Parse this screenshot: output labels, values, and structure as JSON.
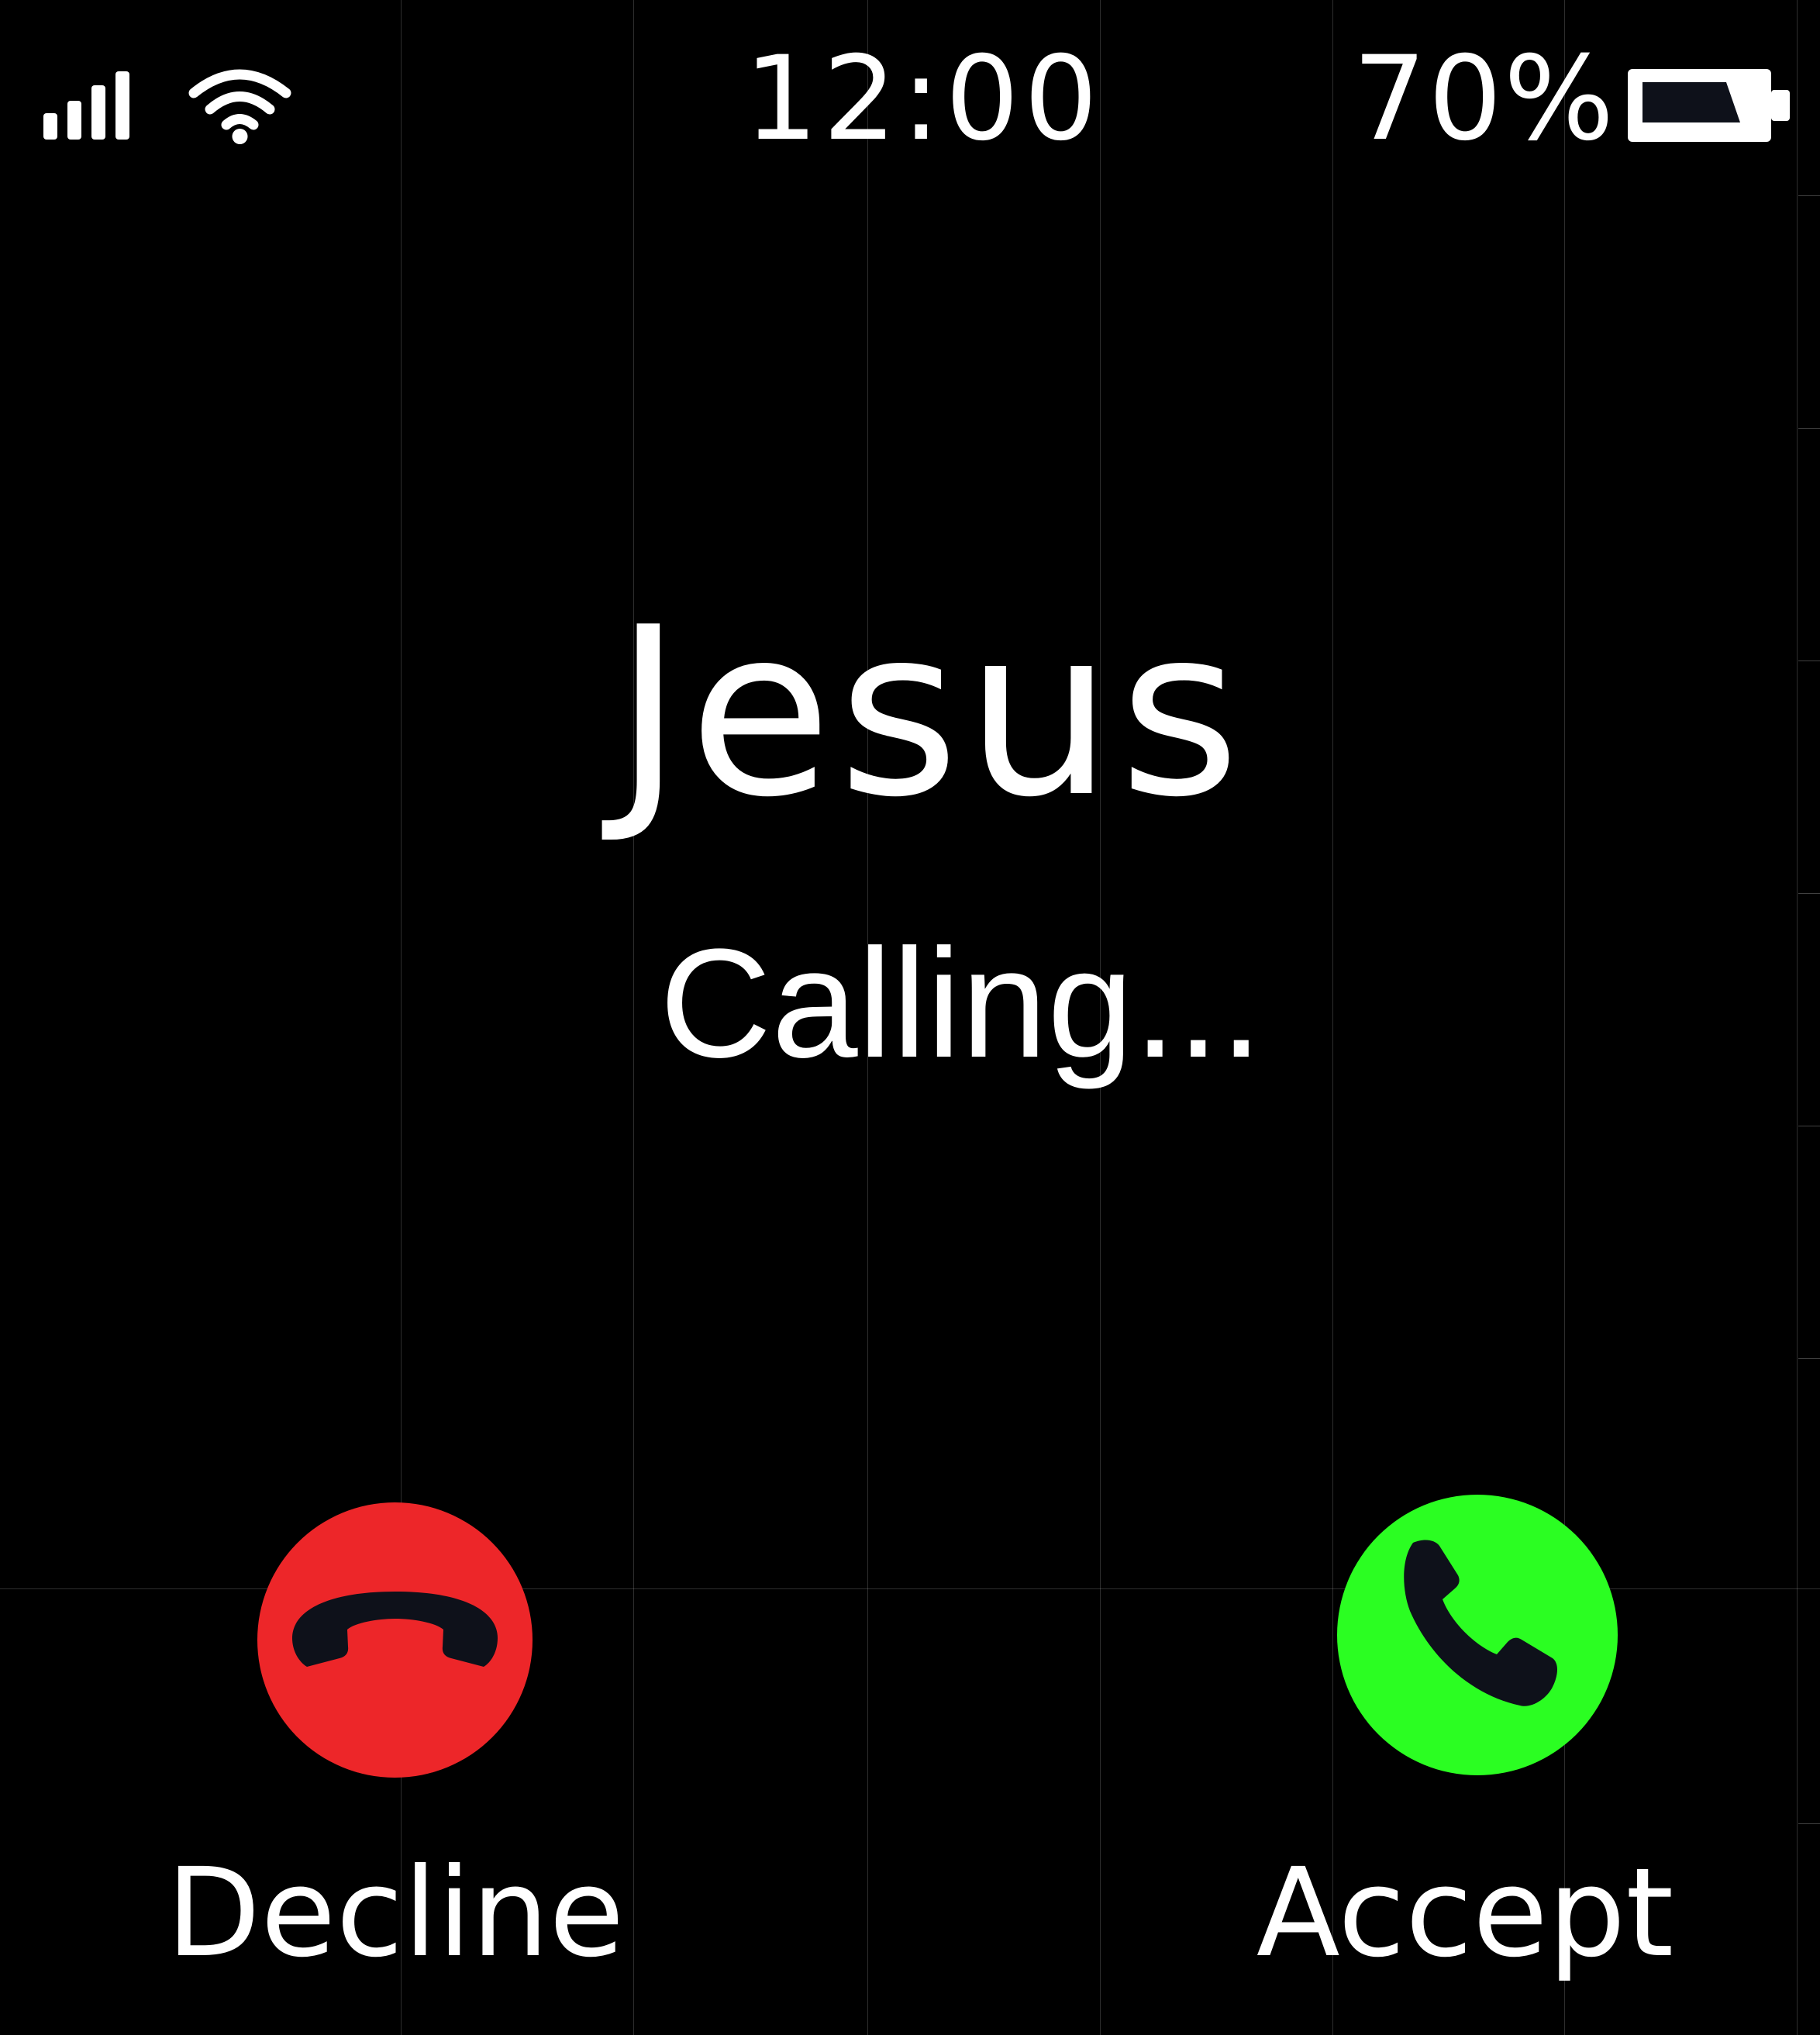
{
  "status_bar": {
    "time": "12:00",
    "battery_percent_label": "70%",
    "battery_level": 0.7,
    "signal_icon": "cellular-signal-icon",
    "wifi_icon": "wifi-icon",
    "battery_icon": "battery-icon"
  },
  "call": {
    "caller_name": "Jesus",
    "status": "Calling..."
  },
  "actions": {
    "decline": {
      "label": "Decline",
      "icon": "phone-hangup-icon",
      "color": "#ed2629"
    },
    "accept": {
      "label": "Accept",
      "icon": "phone-icon",
      "color": "#2bfe22"
    }
  },
  "colors": {
    "background": "#000000",
    "text": "#ffffff",
    "icon_glyph": "#0e111a"
  }
}
